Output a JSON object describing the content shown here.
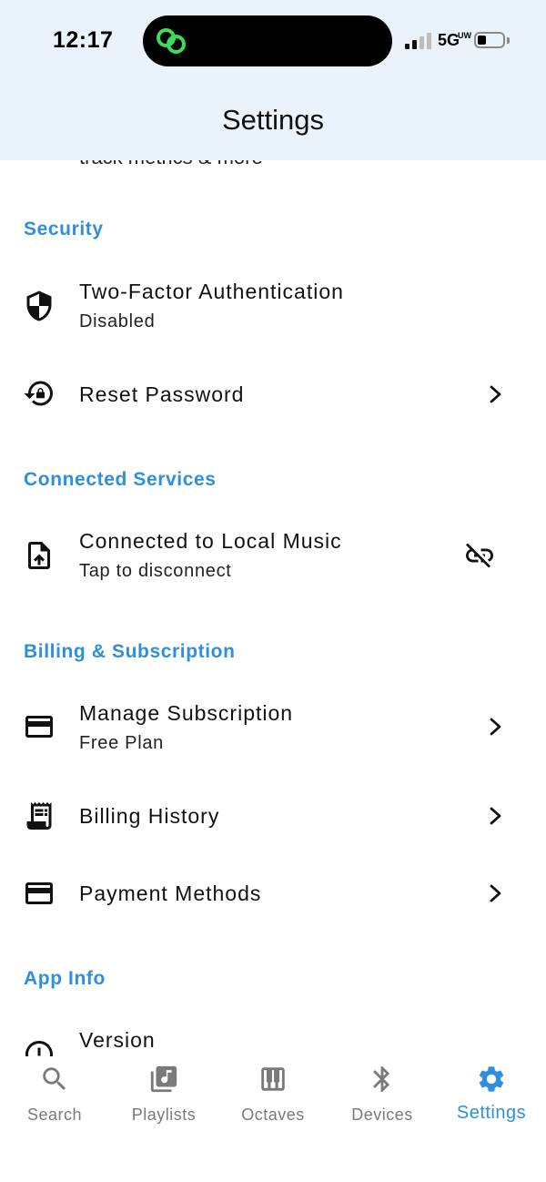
{
  "status_bar": {
    "time": "12:17",
    "network": "5G",
    "network_sub": "UW"
  },
  "header": {
    "title": "Settings"
  },
  "clipped_text": "track metrics & more",
  "sections": {
    "security": {
      "title": "Security",
      "items": [
        {
          "title": "Two-Factor Authentication",
          "subtitle": "Disabled",
          "icon": "shield-icon"
        },
        {
          "title": "Reset Password",
          "icon": "lock-reset-icon"
        }
      ]
    },
    "connected_services": {
      "title": "Connected Services",
      "items": [
        {
          "title": "Connected to Local Music",
          "subtitle": "Tap to disconnect",
          "icon": "file-upload-icon",
          "action_icon": "unlink-icon"
        }
      ]
    },
    "billing": {
      "title": "Billing & Subscription",
      "items": [
        {
          "title": "Manage Subscription",
          "subtitle": "Free Plan",
          "icon": "credit-card-icon"
        },
        {
          "title": "Billing History",
          "icon": "receipt-icon"
        },
        {
          "title": "Payment Methods",
          "icon": "credit-card-icon"
        }
      ]
    },
    "app_info": {
      "title": "App Info",
      "items": [
        {
          "title": "Version",
          "icon": "info-icon"
        }
      ]
    }
  },
  "tabbar": {
    "tabs": [
      {
        "label": "Search",
        "icon": "search-icon"
      },
      {
        "label": "Playlists",
        "icon": "music-library-icon"
      },
      {
        "label": "Octaves",
        "icon": "piano-icon"
      },
      {
        "label": "Devices",
        "icon": "bluetooth-icon"
      },
      {
        "label": "Settings",
        "icon": "gear-icon",
        "active": true
      }
    ]
  },
  "colors": {
    "accent": "#2e8fde",
    "header_bg": "#eaf3fc",
    "island_icon": "#3ddc5a",
    "inactive_tab": "#7a7a7a"
  }
}
